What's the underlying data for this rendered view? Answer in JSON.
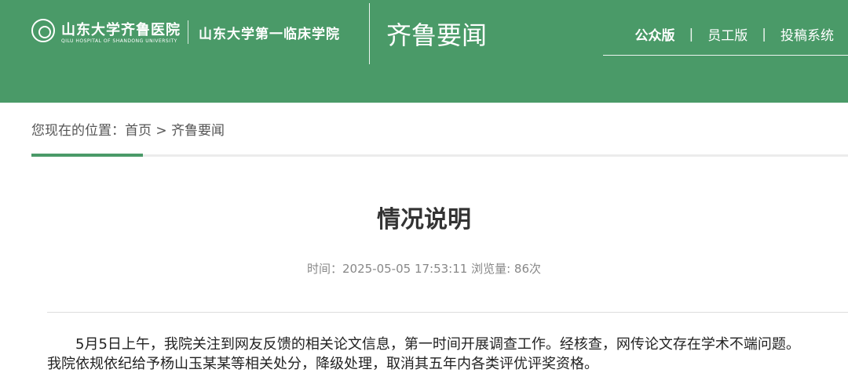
{
  "header": {
    "logo_cn": "山东大学齐鲁医院",
    "logo_en": "QILU HOSPITAL OF SHANDONG UNIVERSITY",
    "logo_sub": "山东大学第一临床学院",
    "section_title": "齐鲁要闻",
    "nav": {
      "public_label": "公众版",
      "staff_label": "员工版",
      "submit_label": "投稿系统",
      "separator": "|"
    }
  },
  "breadcrumb": {
    "prefix": "您现在的位置：",
    "home": "首页",
    "separator": ">",
    "current": "齐鲁要闻"
  },
  "article": {
    "title": "情况说明",
    "meta": "时间：2025-05-05 17:53:11 浏览量: 86次",
    "paragraph_1": "5月5日上午，我院关注到网友反馈的相关论文信息，第一时间开展调查工作。经核查，网传论文存在学术不端问题。",
    "paragraph_2": "我院依规依纪给予杨山玉某某等相关处分，降级处理，取消其五年内各类评优评奖资格。"
  },
  "colors": {
    "brand_green": "#4a9a68",
    "text_dark": "#333333",
    "text_muted": "#888888"
  }
}
